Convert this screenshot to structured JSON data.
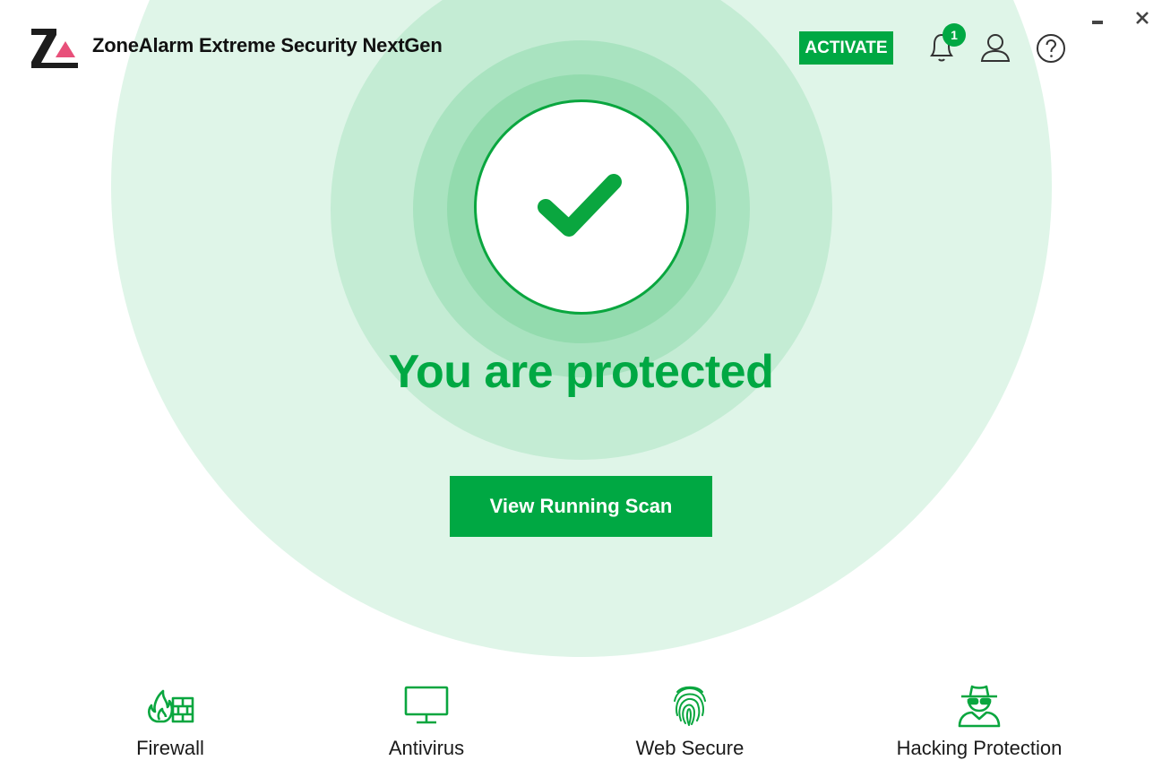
{
  "header": {
    "app_title": "ZoneAlarm Extreme Security NextGen",
    "activate_label": "ACTIVATE",
    "notification_count": "1",
    "icons": {
      "logo": "zonealarm-logo",
      "notifications": "bell-icon",
      "account": "user-icon",
      "help": "help-icon",
      "minimize": "minimize-icon",
      "close": "close-icon"
    }
  },
  "status": {
    "title": "You are protected",
    "icon": "checkmark-icon",
    "scan_button_label": "View Running Scan"
  },
  "features": [
    {
      "label": "Firewall",
      "icon": "firewall-icon"
    },
    {
      "label": "Antivirus",
      "icon": "monitor-icon"
    },
    {
      "label": "Web Secure",
      "icon": "fingerprint-icon"
    },
    {
      "label": "Hacking Protection",
      "icon": "spy-icon"
    }
  ],
  "colors": {
    "accent": "#00a843",
    "ring_outer": "#dff5e8",
    "ring_mid": "#c4ecd4",
    "ring_inner": "#93dbae",
    "logo_pink": "#e8507a"
  }
}
